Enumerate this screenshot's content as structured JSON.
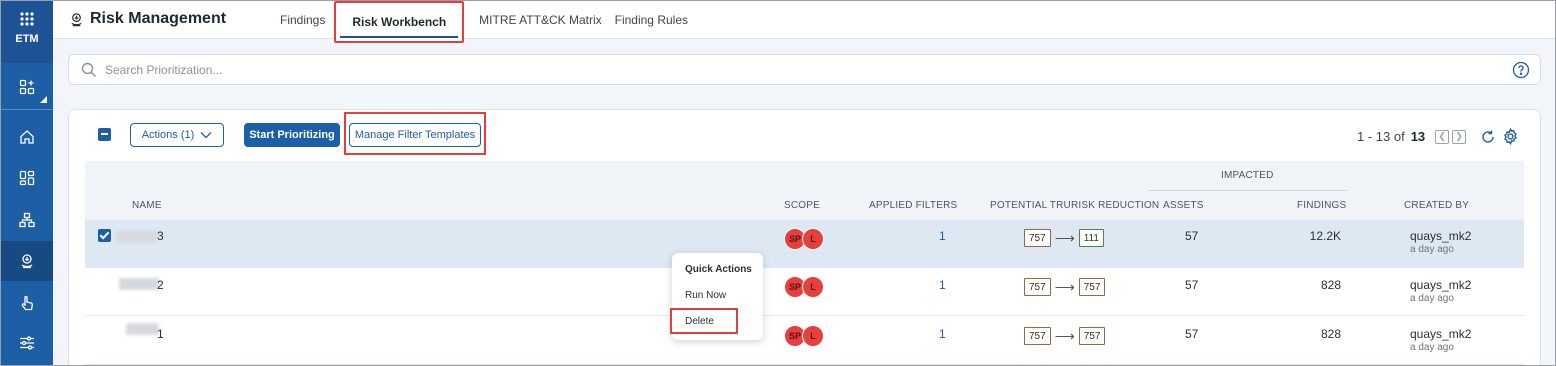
{
  "rail": {
    "label": "ETM",
    "items": [
      "apps-icon",
      "dashboard-add-icon",
      "home-icon",
      "widgets-icon",
      "hierarchy-icon",
      "risk-icon",
      "touch-icon",
      "sliders-icon"
    ]
  },
  "header": {
    "title": "Risk Management",
    "tabs": [
      {
        "label": "Findings"
      },
      {
        "label": "Risk Workbench"
      },
      {
        "label": "MITRE ATT&CK Matrix"
      },
      {
        "label": "Finding Rules"
      }
    ],
    "active_tab": "Risk Workbench"
  },
  "search": {
    "placeholder": "Search Prioritization..."
  },
  "toolbar": {
    "actions_label": "Actions (1)",
    "start_label": "Start Prioritizing",
    "manage_label": "Manage Filter Templates"
  },
  "pagination": {
    "range": "1 - 13 of",
    "total": "13"
  },
  "table": {
    "group_header": "IMPACTED",
    "columns": {
      "name": "NAME",
      "scope": "SCOPE",
      "filters": "APPLIED FILTERS",
      "reduction": "POTENTIAL TRURISK REDUCTION",
      "assets": "ASSETS",
      "findings": "FINDINGS",
      "created_by": "CREATED BY"
    },
    "rows": [
      {
        "name_suffix": "3",
        "scope": [
          "SP",
          "L"
        ],
        "filters": "1",
        "from": "757",
        "to": "111",
        "assets": "57",
        "findings": "12.2K",
        "creator": "quays_mk2",
        "when": "a day ago"
      },
      {
        "name_suffix": "2",
        "scope": [
          "SP",
          "L"
        ],
        "filters": "1",
        "from": "757",
        "to": "757",
        "assets": "57",
        "findings": "828",
        "creator": "quays_mk2",
        "when": "a day ago"
      },
      {
        "name_suffix": "1",
        "scope": [
          "SP",
          "L"
        ],
        "filters": "1",
        "from": "757",
        "to": "757",
        "assets": "57",
        "findings": "828",
        "creator": "quays_mk2",
        "when": "a day ago"
      }
    ]
  },
  "menu": {
    "title": "Quick Actions",
    "items": [
      "Run Now",
      "Delete"
    ]
  },
  "colors": {
    "primary": "#1d5fa6",
    "rail": "#1c5fa5",
    "highlight": "#e0403a",
    "scope_badge": "#e5403e",
    "selected_row": "#dde8f3"
  }
}
